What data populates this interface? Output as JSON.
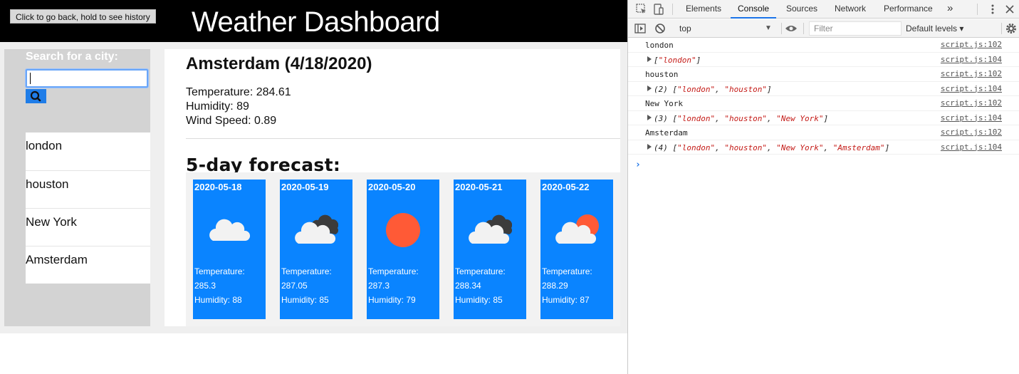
{
  "browser": {
    "back_tooltip": "Click to go back, hold to see history"
  },
  "app": {
    "title": "Weather Dashboard"
  },
  "sidebar": {
    "search_label": "Search for a city:",
    "search_input": {
      "value": "",
      "placeholder": ""
    },
    "search_button_icon": "search-icon",
    "cities": [
      "london",
      "houston",
      "New York",
      "Amsterdam"
    ]
  },
  "current": {
    "title": "Amsterdam (4/18/2020)",
    "temperature": "Temperature: 284.61",
    "humidity": "Humidity: 89",
    "wind": "Wind Speed: 0.89"
  },
  "forecast": {
    "heading": "5-day forecast:",
    "days": [
      {
        "date": "2020-05-18",
        "icon": "cloud-icon",
        "temp_label": "Temperature:",
        "temp": "285.3",
        "humidity": "Humidity: 88"
      },
      {
        "date": "2020-05-19",
        "icon": "dark-clouds-icon",
        "temp_label": "Temperature:",
        "temp": "287.05",
        "humidity": "Humidity: 85"
      },
      {
        "date": "2020-05-20",
        "icon": "sun-icon",
        "temp_label": "Temperature:",
        "temp": "287.3",
        "humidity": "Humidity: 79"
      },
      {
        "date": "2020-05-21",
        "icon": "dark-clouds-icon",
        "temp_label": "Temperature:",
        "temp": "288.34",
        "humidity": "Humidity: 85"
      },
      {
        "date": "2020-05-22",
        "icon": "sun-behind-cloud-icon",
        "temp_label": "Temperature:",
        "temp": "288.29",
        "humidity": "Humidity: 87"
      }
    ]
  },
  "devtools": {
    "tabs": [
      "Elements",
      "Console",
      "Sources",
      "Network",
      "Performance"
    ],
    "more_tabs": "»",
    "active_tab": "Console",
    "context": "top",
    "filter_placeholder": "Filter",
    "levels": "Default levels ▾",
    "log": [
      {
        "type": "text",
        "msg": "london",
        "src": "script.js:102"
      },
      {
        "type": "array",
        "prefix": "",
        "items": [
          "\"london\""
        ],
        "src": "script.js:104"
      },
      {
        "type": "text",
        "msg": "houston",
        "src": "script.js:102"
      },
      {
        "type": "array",
        "prefix": "(2) ",
        "items": [
          "\"london\"",
          "\"houston\""
        ],
        "src": "script.js:104"
      },
      {
        "type": "text",
        "msg": "New York",
        "src": "script.js:102"
      },
      {
        "type": "array",
        "prefix": "(3) ",
        "items": [
          "\"london\"",
          "\"houston\"",
          "\"New York\""
        ],
        "src": "script.js:104"
      },
      {
        "type": "text",
        "msg": "Amsterdam",
        "src": "script.js:102"
      },
      {
        "type": "array",
        "prefix": "(4) ",
        "items": [
          "\"london\"",
          "\"houston\"",
          "\"New York\"",
          "\"Amsterdam\""
        ],
        "src": "script.js:104"
      }
    ],
    "prompt": "›"
  },
  "colors": {
    "accent": "#0a84ff",
    "header": "#000000",
    "sidebar": "#d3d3d3",
    "sun": "#ff5a36",
    "cloud": "#f2f2f2",
    "dark_cloud": "#3c3c3c"
  }
}
